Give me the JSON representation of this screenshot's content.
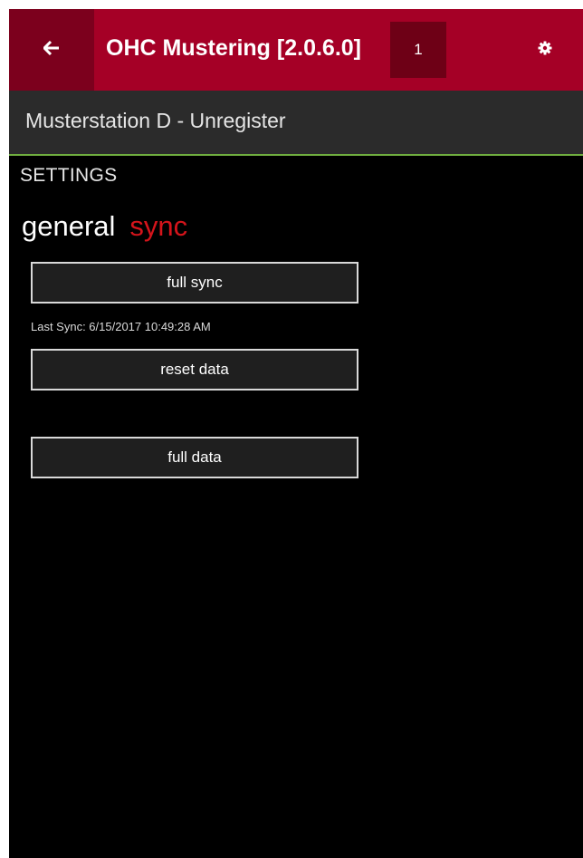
{
  "titlebar": {
    "back_icon": "back-arrow-icon",
    "title": "OHC Mustering [2.0.6.0]",
    "badge_count": "1",
    "settings_icon": "gear-icon",
    "background_color": "#a50026",
    "back_bg_color": "#7c001d"
  },
  "subheader": {
    "text": "Musterstation D - Unregister",
    "accent_color": "#6fae3f"
  },
  "settings": {
    "label": "SETTINGS",
    "tabs": [
      {
        "label": "general",
        "selected": false
      },
      {
        "label": "sync",
        "selected": true
      }
    ],
    "selected_tab_color": "#d4141b"
  },
  "sync": {
    "full_sync_label": "full sync",
    "last_sync": "Last Sync: 6/15/2017 10:49:28 AM",
    "reset_data_label": "reset data",
    "full_data_label": "full data"
  }
}
